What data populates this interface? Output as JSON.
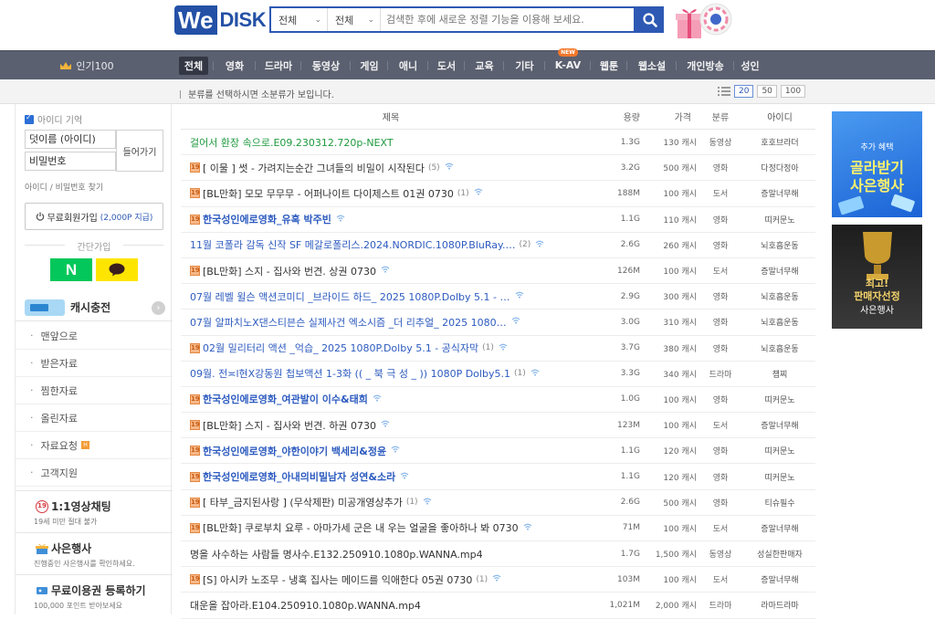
{
  "header": {
    "logo_we": "We",
    "logo_disk": "DISK",
    "select1": "전체",
    "select2": "전체",
    "search_placeholder": "검색한 후에 새로운 정렬 기능을 이용해 보세요."
  },
  "nav": {
    "popular_label": "인기100",
    "new_badge": "NEW",
    "items": [
      "전체",
      "영화",
      "드라마",
      "동영상",
      "게임",
      "애니",
      "도서",
      "교육",
      "기타",
      "K-AV",
      "웹툰",
      "웹소설",
      "개인방송",
      "성인"
    ]
  },
  "subbar": {
    "hint": "분류를 선택하시면 소분류가 보입니다.",
    "page_sizes": [
      "20",
      "50",
      "100"
    ]
  },
  "sidebar": {
    "remember_id": "아이디 기억",
    "id_placeholder": "덧이름 (아이디)",
    "password_label": "비밀번호",
    "login_button": "들어가기",
    "find_link": "아이디 / 비밀번호 찾기",
    "join_text": "무료회원가입",
    "join_points": "(2,000P 지급)",
    "easy_join": "간단가입",
    "naver_label": "N",
    "cash_title": "캐시충전",
    "menu": [
      "맨앞으로",
      "받은자료",
      "찜한자료",
      "올린자료",
      "자료요청",
      "고객지원"
    ],
    "request_badge": "H",
    "promos": [
      {
        "title": "1:1영상채팅",
        "desc": "19세 미만 절대 불가",
        "badge": "19"
      },
      {
        "title": "사은행사",
        "desc": "진행중인 사은행사를 확인하세요."
      },
      {
        "title": "무료이용권 등록하기",
        "desc": "100,000 포인트 받아보세요"
      }
    ]
  },
  "table": {
    "headers": {
      "title": "제목",
      "size": "용량",
      "price": "가격",
      "category": "분류",
      "user": "아이디"
    },
    "rows": [
      {
        "adult": false,
        "style": "green",
        "title": "걸어서 환장 속으로.E09.230312.720p-NEXT",
        "comments": "",
        "wifi": false,
        "size": "1.3G",
        "price": "130 캐시",
        "category": "동영상",
        "user": "호호브라더"
      },
      {
        "adult": true,
        "style": "dark",
        "title": "[ 이물 ] 썻 - 가려지는순간 그녀들의 비밀이 시작된다",
        "comments": "(5)",
        "wifi": true,
        "size": "3.2G",
        "price": "500 캐시",
        "category": "영화",
        "user": "다정다정아"
      },
      {
        "adult": true,
        "style": "dark",
        "title": "[BL만화] 모모 무무무 - 어퍼나이트 다이제스트 01권 0730",
        "comments": "(1)",
        "wifi": true,
        "size": "188M",
        "price": "100 캐시",
        "category": "도서",
        "user": "증말너무해"
      },
      {
        "adult": true,
        "style": "blue",
        "title": "한국성인에로영화_유혹 박주빈",
        "comments": "",
        "wifi": true,
        "size": "1.1G",
        "price": "110 캐시",
        "category": "영화",
        "user": "띠커문노"
      },
      {
        "adult": false,
        "style": "blue2",
        "title": "11월 코폴라 감독 신작 SF 메갈로폴리스.2024.NORDIC.1080P.BluRay.…",
        "comments": "(2)",
        "wifi": true,
        "size": "2.6G",
        "price": "260 캐시",
        "category": "영화",
        "user": "뇌호흡운동"
      },
      {
        "adult": true,
        "style": "dark",
        "title": "[BL만화] 스지 - 집사와 번견. 상권 0730",
        "comments": "",
        "wifi": true,
        "size": "126M",
        "price": "100 캐시",
        "category": "도서",
        "user": "증말너무해"
      },
      {
        "adult": false,
        "style": "blue2",
        "title": "07월 레벨 윌슨 액션코미디 _브라이드 하드_ 2025 1080P.Dolby 5.1 - …",
        "comments": "",
        "wifi": true,
        "size": "2.9G",
        "price": "300 캐시",
        "category": "영화",
        "user": "뇌호흡운동"
      },
      {
        "adult": false,
        "style": "blue2",
        "title": "07월 알파치노X댄스티븐슨 실제사건 엑소시즘 _더 리추얼_ 2025 1080…",
        "comments": "",
        "wifi": true,
        "size": "3.0G",
        "price": "310 캐시",
        "category": "영화",
        "user": "뇌호흡운동"
      },
      {
        "adult": true,
        "style": "blue2",
        "title": "02월 밀리터리 액션 _억습_ 2025 1080P.Dolby 5.1 - 공식자막",
        "comments": "(1)",
        "wifi": true,
        "size": "3.7G",
        "price": "380 캐시",
        "category": "영화",
        "user": "뇌호흡운동"
      },
      {
        "adult": false,
        "style": "blue2",
        "title": "09월. 전≍l현X강동원 첩보액션 1-3화 (( _ 북 극 성 _ )) 1080P Dolby5.1",
        "comments": "(1)",
        "wifi": true,
        "size": "3.3G",
        "price": "340 캐시",
        "category": "드라마",
        "user": "첍찌"
      },
      {
        "adult": true,
        "style": "blue",
        "title": "한국성인에로영화_여관발이 이수&태희",
        "comments": "",
        "wifi": true,
        "size": "1.0G",
        "price": "100 캐시",
        "category": "영화",
        "user": "띠커문노"
      },
      {
        "adult": true,
        "style": "dark",
        "title": "[BL만화] 스지 - 집사와 번견. 하권 0730",
        "comments": "",
        "wifi": true,
        "size": "123M",
        "price": "100 캐시",
        "category": "도서",
        "user": "증말너무해"
      },
      {
        "adult": true,
        "style": "blue",
        "title": "한국성인에로영화_야한이야기 백세리&정윤",
        "comments": "",
        "wifi": true,
        "size": "1.1G",
        "price": "120 캐시",
        "category": "영화",
        "user": "띠커문노"
      },
      {
        "adult": true,
        "style": "blue",
        "title": "한국성인에로영화_아내의비밀남자 성연&소라",
        "comments": "",
        "wifi": true,
        "size": "1.1G",
        "price": "120 캐시",
        "category": "영화",
        "user": "띠커문노"
      },
      {
        "adult": true,
        "style": "dark",
        "title": "[ 타부_금지된사랑 ] (무삭제판) 미공개영상추가",
        "comments": "(1)",
        "wifi": true,
        "size": "2.6G",
        "price": "500 캐시",
        "category": "영화",
        "user": "티슈필수"
      },
      {
        "adult": true,
        "style": "dark",
        "title": "[BL만화] 쿠로부치 요루 - 아마가세 군은 내 우는 얼굴을 좋아하나 봐 0730",
        "comments": "",
        "wifi": true,
        "size": "71M",
        "price": "100 캐시",
        "category": "도서",
        "user": "증말너무해"
      },
      {
        "adult": false,
        "style": "dark",
        "title": "명을 사수하는 사람들 명사수.E132.250910.1080p.WANNA.mp4",
        "comments": "",
        "wifi": false,
        "size": "1.7G",
        "price": "1,500 캐시",
        "category": "동영상",
        "user": "성실한판매자"
      },
      {
        "adult": true,
        "style": "dark",
        "title": "[S] 아시카 노조무 - 냉혹 집사는 메이드를 익애한다 05권 0730",
        "comments": "(1)",
        "wifi": true,
        "size": "103M",
        "price": "100 캐시",
        "category": "도서",
        "user": "증말너무해"
      },
      {
        "adult": false,
        "style": "dark",
        "title": "대운을 잡아라.E104.250910.1080p.WANNA.mp4",
        "comments": "",
        "wifi": false,
        "size": "1,021M",
        "price": "2,000 캐시",
        "category": "드라마",
        "user": "라마드라마"
      }
    ]
  },
  "ads": {
    "ad1_top": "추가 혜택",
    "ad1_main1": "골라받기",
    "ad1_main2": "사은행사",
    "ad2_main1": "최고!",
    "ad2_main2": "판매자선정",
    "ad2_main3": "사은행사"
  },
  "colors": {
    "brand_blue": "#2d59b4",
    "nav_bg": "#5b6070",
    "naver_green": "#03c75a",
    "kakao_yellow": "#fee500"
  }
}
